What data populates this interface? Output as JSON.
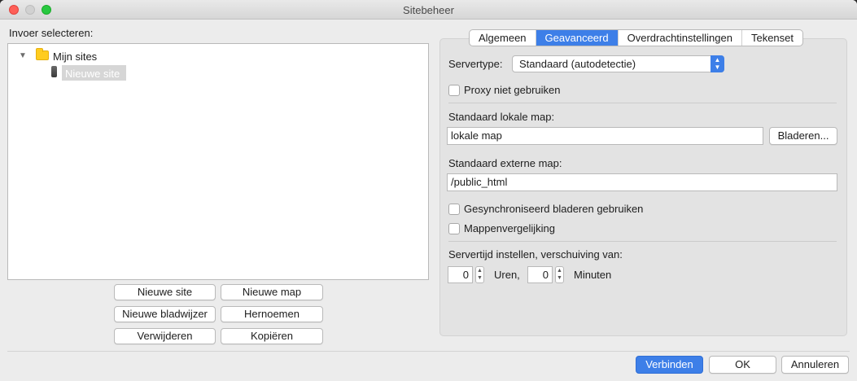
{
  "window": {
    "title": "Sitebeheer"
  },
  "left": {
    "label": "Invoer selecteren:",
    "tree": {
      "root": "Mijn sites",
      "child": "Nieuwe site"
    },
    "buttons": {
      "new_site": "Nieuwe site",
      "new_folder": "Nieuwe map",
      "new_bookmark": "Nieuwe bladwijzer",
      "rename": "Hernoemen",
      "delete": "Verwijderen",
      "copy": "Kopiëren"
    }
  },
  "tabs": [
    "Algemeen",
    "Geavanceerd",
    "Overdrachtinstellingen",
    "Tekenset"
  ],
  "advanced": {
    "servertype_label": "Servertype:",
    "servertype_value": "Standaard (autodetectie)",
    "proxy_label": "Proxy niet gebruiken",
    "local_dir_label": "Standaard lokale map:",
    "local_dir_value": "lokale map",
    "browse_label": "Bladeren...",
    "remote_dir_label": "Standaard externe map:",
    "remote_dir_value": "/public_html",
    "sync_label": "Gesynchroniseerd bladeren gebruiken",
    "compare_label": "Mappenvergelijking",
    "time_offset_label": "Servertijd instellen, verschuiving van:",
    "hours_value": "0",
    "hours_label": "Uren,",
    "minutes_value": "0",
    "minutes_label": "Minuten"
  },
  "footer": {
    "connect": "Verbinden",
    "ok": "OK",
    "cancel": "Annuleren"
  },
  "colors": {
    "accent": "#3d7fe8"
  }
}
